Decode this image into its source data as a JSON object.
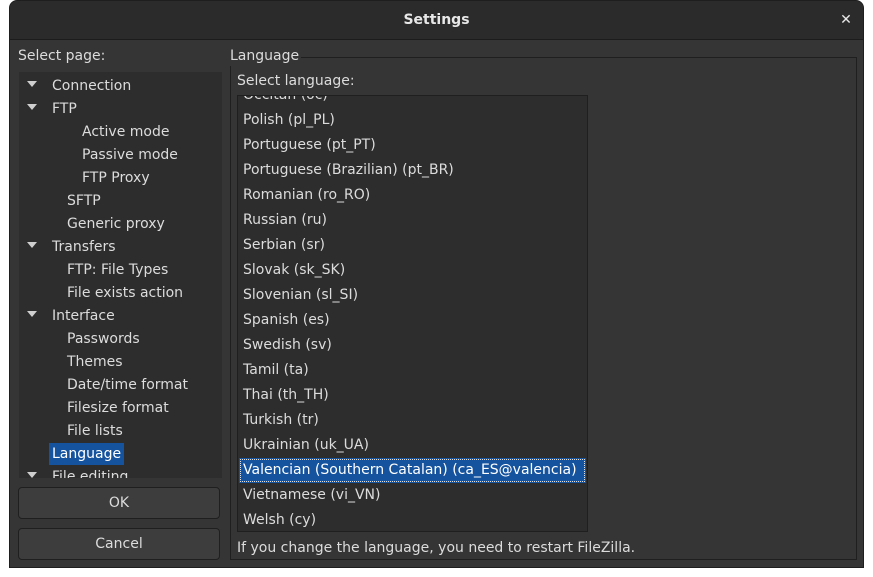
{
  "window": {
    "title": "Settings"
  },
  "tree": {
    "header": "Select page:",
    "items": [
      {
        "label": "Connection",
        "expanded": true
      },
      {
        "label": "FTP",
        "expanded": true
      },
      {
        "label": "Active mode"
      },
      {
        "label": "Passive mode"
      },
      {
        "label": "FTP Proxy"
      },
      {
        "label": "SFTP"
      },
      {
        "label": "Generic proxy"
      },
      {
        "label": "Transfers",
        "expanded": true
      },
      {
        "label": "FTP: File Types"
      },
      {
        "label": "File exists action"
      },
      {
        "label": "Interface",
        "expanded": true
      },
      {
        "label": "Passwords"
      },
      {
        "label": "Themes"
      },
      {
        "label": "Date/time format"
      },
      {
        "label": "Filesize format"
      },
      {
        "label": "File lists"
      },
      {
        "label": "Language",
        "selected": true
      },
      {
        "label": "File editing",
        "expanded": true
      }
    ]
  },
  "buttons": {
    "ok": "OK",
    "cancel": "Cancel"
  },
  "language_page": {
    "frame_title": "Language",
    "select_label": "Select language:",
    "languages": [
      "Occitan (oc)",
      "Polish (pl_PL)",
      "Portuguese (pt_PT)",
      "Portuguese (Brazilian) (pt_BR)",
      "Romanian (ro_RO)",
      "Russian (ru)",
      "Serbian (sr)",
      "Slovak (sk_SK)",
      "Slovenian (sl_SI)",
      "Spanish (es)",
      "Swedish (sv)",
      "Tamil (ta)",
      "Thai (th_TH)",
      "Turkish (tr)",
      "Ukrainian (uk_UA)",
      "Valencian (Southern Catalan) (ca_ES@valencia)",
      "Vietnamese (vi_VN)",
      "Welsh (cy)"
    ],
    "selected_language": "Valencian (Southern Catalan) (ca_ES@valencia)",
    "note": "If you change the language, you need to restart FileZilla."
  },
  "icons": {
    "close": "close-icon",
    "expand": "chevron-down-icon"
  },
  "colors": {
    "selection": "#15539e",
    "background": "#353535",
    "list_background": "#2d2d2d"
  }
}
